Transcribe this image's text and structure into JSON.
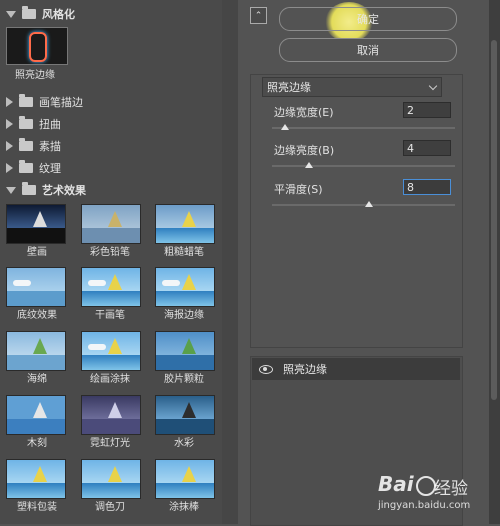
{
  "categories": {
    "stylize": "风格化",
    "brush_strokes": "画笔描边",
    "distort": "扭曲",
    "sketch": "素描",
    "texture": "纹理",
    "artistic": "艺术效果"
  },
  "selected_thumb_label": "照亮边缘",
  "artistic_filters": [
    "壁画",
    "彩色铅笔",
    "粗糙蜡笔",
    "底纹效果",
    "干画笔",
    "海报边缘",
    "海绵",
    "绘画涂抹",
    "胶片颗粒",
    "木刻",
    "霓虹灯光",
    "水彩",
    "塑料包装",
    "调色刀",
    "涂抹棒"
  ],
  "buttons": {
    "ok": "确定",
    "cancel": "取消"
  },
  "filter_dropdown": "照亮边缘",
  "params": [
    {
      "label": "边缘宽度(E)",
      "value": "2",
      "level": 0.07
    },
    {
      "label": "边缘亮度(B)",
      "value": "4",
      "level": 0.2
    },
    {
      "label": "平滑度(S)",
      "value": "8",
      "level": 0.53
    }
  ],
  "layer_name": "照亮边缘",
  "watermark": {
    "logo": "Bai",
    "text": "经验",
    "url": "jingyan.baidu.com"
  },
  "colors": {
    "accent_highlight": "#e3dc5a",
    "active_input_border": "#4a8fd8"
  }
}
